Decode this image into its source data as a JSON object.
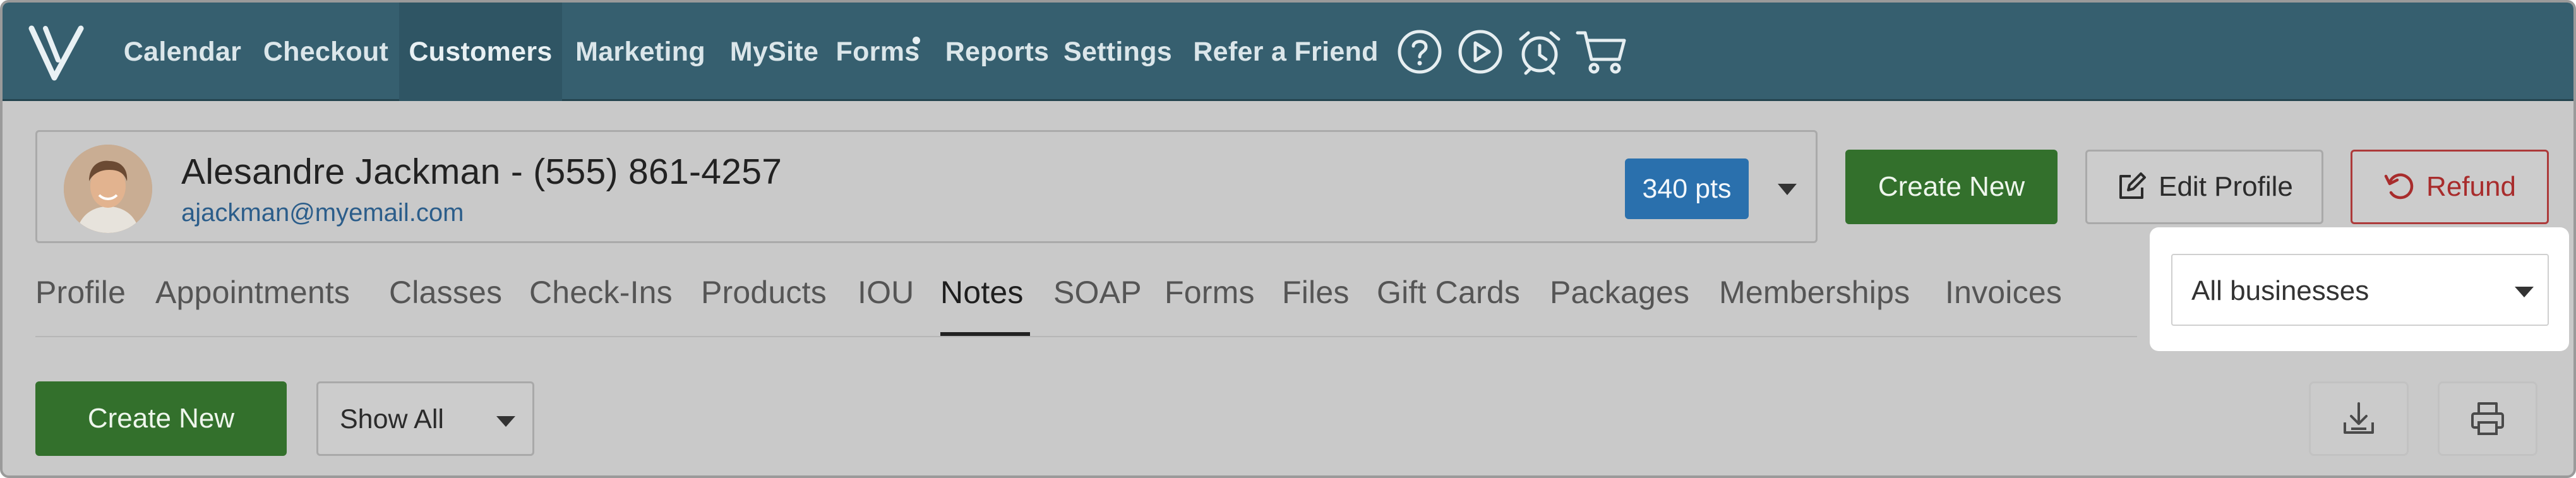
{
  "nav": {
    "items": [
      {
        "label": "Calendar"
      },
      {
        "label": "Checkout"
      },
      {
        "label": "Customers"
      },
      {
        "label": "Marketing"
      },
      {
        "label": "MySite"
      },
      {
        "label": "Forms"
      },
      {
        "label": "Reports"
      },
      {
        "label": "Settings"
      },
      {
        "label": "Refer a Friend"
      }
    ],
    "active": "Customers",
    "icons": [
      "help-icon",
      "play-icon",
      "alarm-clock-icon",
      "cart-icon"
    ]
  },
  "customer": {
    "name_phone": "Alesandre Jackman - (555) 861-4257",
    "email": "ajackman@myemail.com",
    "points": "340 pts"
  },
  "actions": {
    "create_new": "Create New",
    "edit_profile": "Edit Profile",
    "refund": "Refund"
  },
  "tabs": {
    "items": [
      {
        "label": "Profile"
      },
      {
        "label": "Appointments"
      },
      {
        "label": "Classes"
      },
      {
        "label": "Check-Ins"
      },
      {
        "label": "Products"
      },
      {
        "label": "IOU"
      },
      {
        "label": "Notes"
      },
      {
        "label": "SOAP"
      },
      {
        "label": "Forms"
      },
      {
        "label": "Files"
      },
      {
        "label": "Gift Cards"
      },
      {
        "label": "Packages"
      },
      {
        "label": "Memberships"
      },
      {
        "label": "Invoices"
      }
    ],
    "active": "Notes"
  },
  "business_filter": {
    "selected": "All businesses"
  },
  "notes_toolbar": {
    "create_new": "Create New",
    "filter_selected": "Show All",
    "icons": [
      "download-icon",
      "print-icon"
    ]
  },
  "colors": {
    "nav_bg": "#365f6f",
    "primary_green": "#33702c",
    "points_blue": "#2a70ad",
    "refund_red": "#a82c2c",
    "link_blue": "#2b5d8a"
  }
}
